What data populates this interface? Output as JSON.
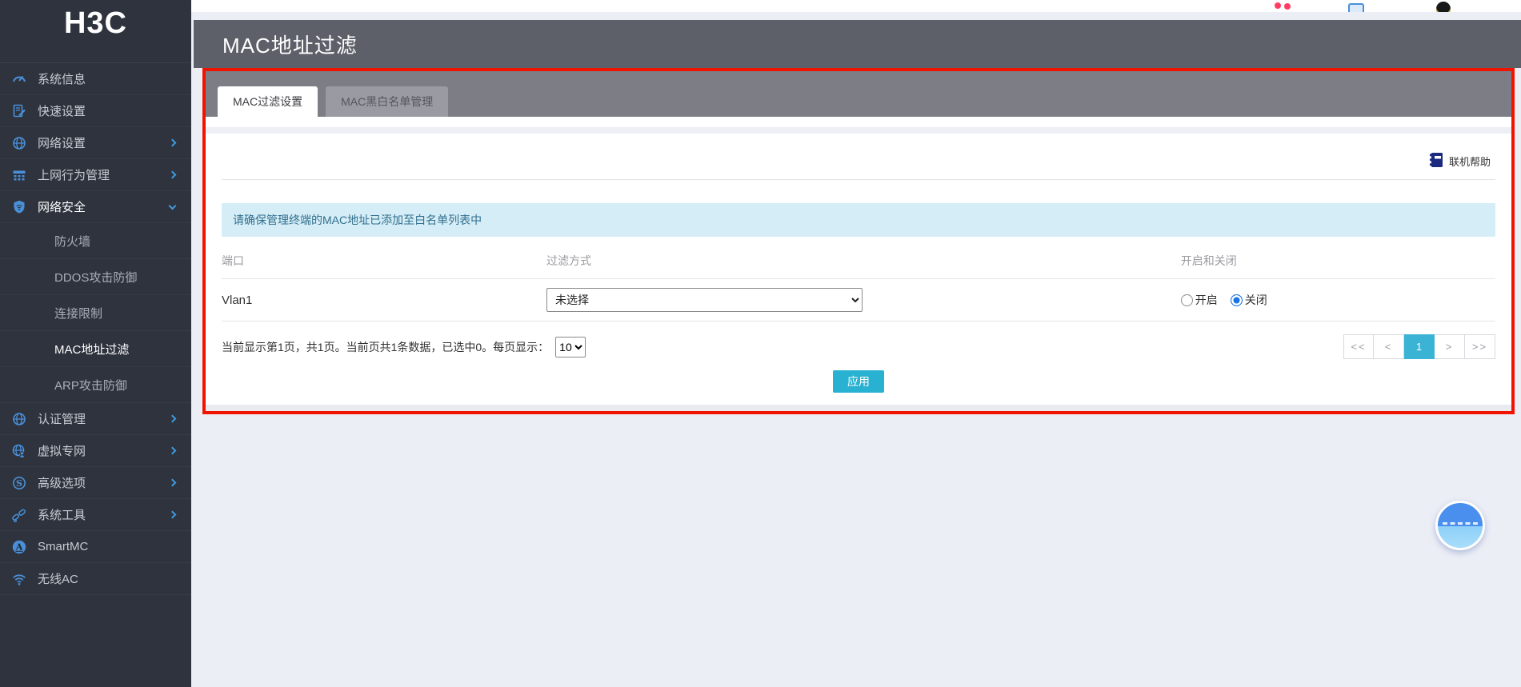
{
  "sidebar": {
    "logo": "H3C",
    "items": [
      {
        "label": "系统信息",
        "icon": "gauge"
      },
      {
        "label": "快速设置",
        "icon": "quick-setup"
      },
      {
        "label": "网络设置",
        "icon": "globe",
        "expandable": true
      },
      {
        "label": "上网行为管理",
        "icon": "behavior-bridge",
        "expandable": true
      },
      {
        "label": "网络安全",
        "icon": "shield",
        "expandable": true,
        "expanded": true,
        "children": [
          {
            "label": "防火墙"
          },
          {
            "label": "DDOS攻击防御"
          },
          {
            "label": "连接限制"
          },
          {
            "label": "MAC地址过滤",
            "active": true
          },
          {
            "label": "ARP攻击防御"
          }
        ]
      },
      {
        "label": "认证管理",
        "icon": "globe",
        "expandable": true
      },
      {
        "label": "虚拟专网",
        "icon": "globe-user",
        "expandable": true
      },
      {
        "label": "高级选项",
        "icon": "s-circle",
        "expandable": true
      },
      {
        "label": "系统工具",
        "icon": "chain-tools",
        "expandable": true
      },
      {
        "label": "SmartMC",
        "icon": "a-circle"
      },
      {
        "label": "无线AC",
        "icon": "wifi"
      }
    ]
  },
  "header": {
    "title": "MAC地址过滤"
  },
  "tabs": [
    {
      "label": "MAC过滤设置",
      "active": true
    },
    {
      "label": "MAC黑白名单管理",
      "active": false
    }
  ],
  "help": {
    "label": "联机帮助",
    "icon": "book"
  },
  "notice": {
    "text": "请确保管理终端的MAC地址已添加至白名单列表中"
  },
  "table": {
    "headers": [
      "端口",
      "过滤方式",
      "开启和关闭"
    ],
    "rows": [
      {
        "port": "Vlan1",
        "filter_selected": "未选择",
        "toggle_options": [
          {
            "label": "开启",
            "selected": false
          },
          {
            "label": "关闭",
            "selected": true
          }
        ]
      }
    ]
  },
  "pagination": {
    "summary": "当前显示第1页，共1页。当前页共1条数据，已选中0。每页显示：",
    "page_size": "10",
    "buttons": [
      "<<",
      "<",
      "1",
      ">",
      ">>"
    ],
    "active_page": "1"
  },
  "actions": {
    "apply": "应用"
  },
  "colors": {
    "accent_cyan": "#29b1d1",
    "highlight_red": "#f01400",
    "sidebar_bg": "#2e333d",
    "icon_blue": "#4a90d9",
    "notice_bg": "#d5edf6",
    "header_band": "#5d6069"
  }
}
